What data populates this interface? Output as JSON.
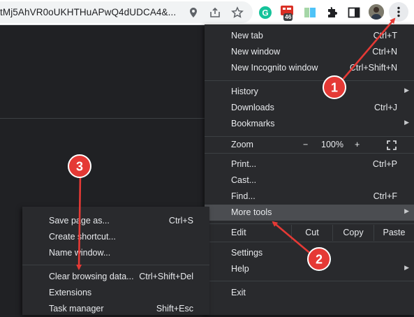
{
  "toolbar": {
    "url": "tMj5AhVR0oUKHTHuAPwQ4dUDCA4&...",
    "extension_badge": "46",
    "icons": [
      "location-icon",
      "share-icon",
      "bookmark-star-icon",
      "grammarly-icon",
      "extension-red-icon",
      "reading-list-icon",
      "extensions-puzzle-icon",
      "side-panel-icon",
      "profile-avatar",
      "kebab-menu-icon"
    ]
  },
  "menu": {
    "new_tab": {
      "label": "New tab",
      "shortcut": "Ctrl+T"
    },
    "new_window": {
      "label": "New window",
      "shortcut": "Ctrl+N"
    },
    "incognito": {
      "label": "New Incognito window",
      "shortcut": "Ctrl+Shift+N"
    },
    "history": {
      "label": "History"
    },
    "downloads": {
      "label": "Downloads",
      "shortcut": "Ctrl+J"
    },
    "bookmarks": {
      "label": "Bookmarks"
    },
    "zoom": {
      "label": "Zoom",
      "minus": "−",
      "value": "100%",
      "plus": "+"
    },
    "print": {
      "label": "Print...",
      "shortcut": "Ctrl+P"
    },
    "cast": {
      "label": "Cast..."
    },
    "find": {
      "label": "Find...",
      "shortcut": "Ctrl+F"
    },
    "more_tools": {
      "label": "More tools"
    },
    "edit": {
      "label": "Edit",
      "cut": "Cut",
      "copy": "Copy",
      "paste": "Paste"
    },
    "settings": {
      "label": "Settings"
    },
    "help": {
      "label": "Help"
    },
    "exit": {
      "label": "Exit"
    }
  },
  "submenu": {
    "save_page": {
      "label": "Save page as...",
      "shortcut": "Ctrl+S"
    },
    "create_shortcut": {
      "label": "Create shortcut..."
    },
    "name_window": {
      "label": "Name window..."
    },
    "clear_browsing": {
      "label": "Clear browsing data...",
      "shortcut": "Ctrl+Shift+Del"
    },
    "extensions": {
      "label": "Extensions"
    },
    "task_manager": {
      "label": "Task manager",
      "shortcut": "Shift+Esc"
    }
  },
  "annotations": {
    "step1": "1",
    "step2": "2",
    "step3": "3",
    "color": "#e53935"
  }
}
